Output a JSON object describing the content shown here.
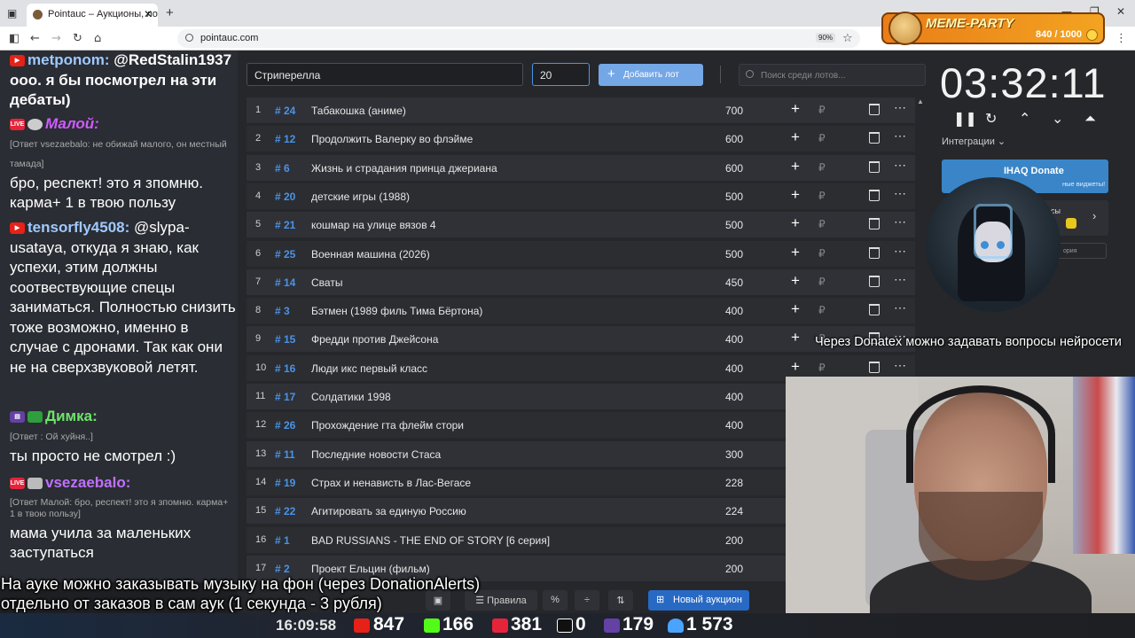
{
  "browser": {
    "tab_title": "Pointauc – Аукционы, лотереи",
    "url": "pointauc.com",
    "zoom": "90%"
  },
  "meme_widget": {
    "title": "MEME-PARTY",
    "progress_text": "840 / 1000",
    "progress_fraction": 0.84
  },
  "chat": {
    "messages": [
      {
        "user": "metponom:",
        "text": "@RedStalin1937 ооо. я бы посмотрел на эти дебаты)"
      },
      {
        "user": "Малой:",
        "reply": "[Ответ vsezaebalo: не обижай малого, он местный тамада]",
        "text": "бро, респект! это я зпомню. карма+ 1 в твою пользу"
      },
      {
        "user": "tensorfly4508:",
        "text": "@slypa-usataya, откуда я знаю, как успехи, этим должны соотвествующие спецы заниматься. Полностью снизить тоже возможно, именно в случае с дронами. Так как они не на сверхзвуковой летят."
      },
      {
        "user": "Димка:",
        "reply": "[Ответ : Ой хуйня..]",
        "text": "ты просто не смотрел :)"
      },
      {
        "user": "vsezaebalo:",
        "reply": "[Ответ Малой: бро, респект! это я зпомню. карма+ 1 в твою пользу]",
        "text": "мама учила за маленьких заступаться"
      }
    ]
  },
  "auction": {
    "lot_name_value": "Стриперелла",
    "amount_value": "20",
    "add_button": "Добавить лот",
    "search_placeholder": "Поиск среди лотов...",
    "lots": [
      {
        "idx": "1",
        "num": "# 24",
        "name": "Табакошка (аниме)",
        "amount": "700"
      },
      {
        "idx": "2",
        "num": "# 12",
        "name": "Продолжить Валерку во флэйме",
        "amount": "600"
      },
      {
        "idx": "3",
        "num": "# 6",
        "name": "Жизнь и страдания принца джериана",
        "amount": "600"
      },
      {
        "idx": "4",
        "num": "# 20",
        "name": "детские игры (1988)",
        "amount": "500"
      },
      {
        "idx": "5",
        "num": "# 21",
        "name": "кошмар на улице вязов 4",
        "amount": "500"
      },
      {
        "idx": "6",
        "num": "# 25",
        "name": "Военная машина (2026)",
        "amount": "500"
      },
      {
        "idx": "7",
        "num": "# 14",
        "name": "Сваты",
        "amount": "450"
      },
      {
        "idx": "8",
        "num": "# 3",
        "name": "Бэтмен (1989 филь Тима Бёртона)",
        "amount": "400"
      },
      {
        "idx": "9",
        "num": "# 15",
        "name": "Фредди против Джейсона",
        "amount": "400"
      },
      {
        "idx": "10",
        "num": "# 16",
        "name": "Люди икс первый класс",
        "amount": "400"
      },
      {
        "idx": "11",
        "num": "# 17",
        "name": "Солдатики 1998",
        "amount": "400"
      },
      {
        "idx": "12",
        "num": "# 26",
        "name": "Прохождение гта флейм стори",
        "amount": "400"
      },
      {
        "idx": "13",
        "num": "# 11",
        "name": "Последние новости Стаса",
        "amount": "300"
      },
      {
        "idx": "14",
        "num": "# 19",
        "name": "Страх и ненависть в Лас-Вегасе",
        "amount": "228"
      },
      {
        "idx": "15",
        "num": "# 22",
        "name": "Агитировать за единую Россию",
        "amount": "224"
      },
      {
        "idx": "16",
        "num": "# 1",
        "name": "BAD RUSSIANS - THE END OF STORY [6 серия]",
        "amount": "200"
      },
      {
        "idx": "17",
        "num": "# 2",
        "name": "Проект Ельцин (фильм)",
        "amount": "200"
      }
    ],
    "currency_symbol": "₽",
    "toolbar": {
      "rules": "Правила",
      "new_auction": "Новый аукцион"
    }
  },
  "right_panel": {
    "timer": "03:32:11",
    "integrations": "Интеграции",
    "ihaq_title": "IHAQ Donate",
    "ihaq_sub": "ные виджеты!",
    "panel2_text": "исы",
    "panel3_text": "ория"
  },
  "overlays": {
    "donate_caption": "Через Donatex можно задавать вопросы нейросети",
    "subtitle_line1": "На ауке можно заказывать музыку на фон (через DonationAlerts)",
    "subtitle_line2": "отдельно от заказов в сам аук (1 секунда - 3 рубля)"
  },
  "stream_stats": {
    "time": "16:09:58",
    "youtube": "847",
    "kick": "166",
    "live": "381",
    "rumble": "0",
    "twitch": "179",
    "total": "1 573"
  },
  "colors": {
    "accent_blue": "#4a93e8",
    "add_button": "#74a7e6",
    "new_auction": "#2869c4",
    "meme_orange": "#e97e18"
  }
}
